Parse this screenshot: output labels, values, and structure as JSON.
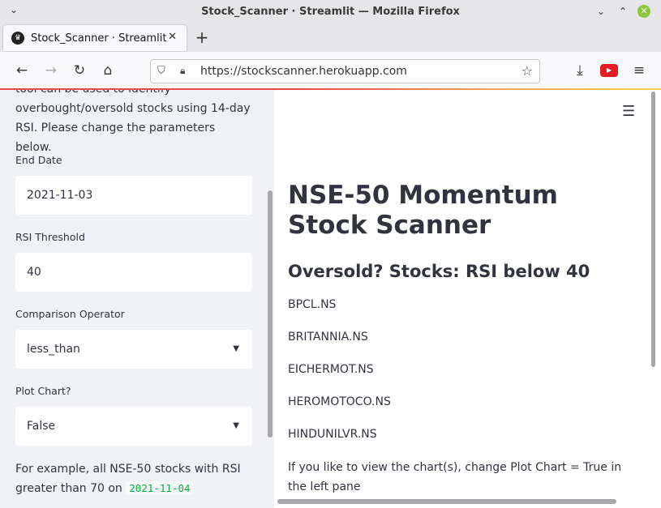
{
  "window": {
    "title": "Stock_Scanner · Streamlit — Mozilla Firefox"
  },
  "tab": {
    "label": "Stock_Scanner · Streamlit",
    "close": "✕",
    "new_tab": "+"
  },
  "nav": {
    "url": "https://stockscanner.herokuapp.com"
  },
  "sidebar": {
    "intro": "tool can be used to identify overbought/oversold stocks using 14-day RSI. Please change the parameters below.",
    "end_date_label": "End Date",
    "end_date_value": "2021-11-03",
    "rsi_threshold_label": "RSI Threshold",
    "rsi_threshold_value": "40",
    "operator_label": "Comparison Operator",
    "operator_value": "less_than",
    "plot_chart_label": "Plot Chart?",
    "plot_chart_value": "False",
    "example_text": "For example, all NSE-50 stocks with RSI greater than 70 on",
    "example_code": "2021-11-04"
  },
  "main": {
    "title": "NSE-50 Momentum Stock Scanner",
    "subtitle": "Oversold? Stocks: RSI below 40",
    "stocks": [
      "BPCL.NS",
      "BRITANNIA.NS",
      "EICHERMOT.NS",
      "HEROMOTOCO.NS",
      "HINDUNILVR.NS"
    ],
    "note": "If you like to view the chart(s), change Plot Chart = True in the left pane"
  },
  "icons": {
    "window_menu": "chevron-down-icon",
    "back": "arrow-left-icon",
    "forward": "arrow-right-icon",
    "reload": "reload-icon",
    "home": "home-icon",
    "tracking": "shield-icon",
    "lock": "lock-icon",
    "bookmark": "star-icon",
    "downloads": "download-icon",
    "extension": "youtube-icon",
    "app_menu": "hamburger-icon"
  },
  "colors": {
    "sidebar_bg": "#f0f2f6",
    "code_green": "#09ab3b",
    "text": "#31333f",
    "window_close": "#8dc53e"
  }
}
